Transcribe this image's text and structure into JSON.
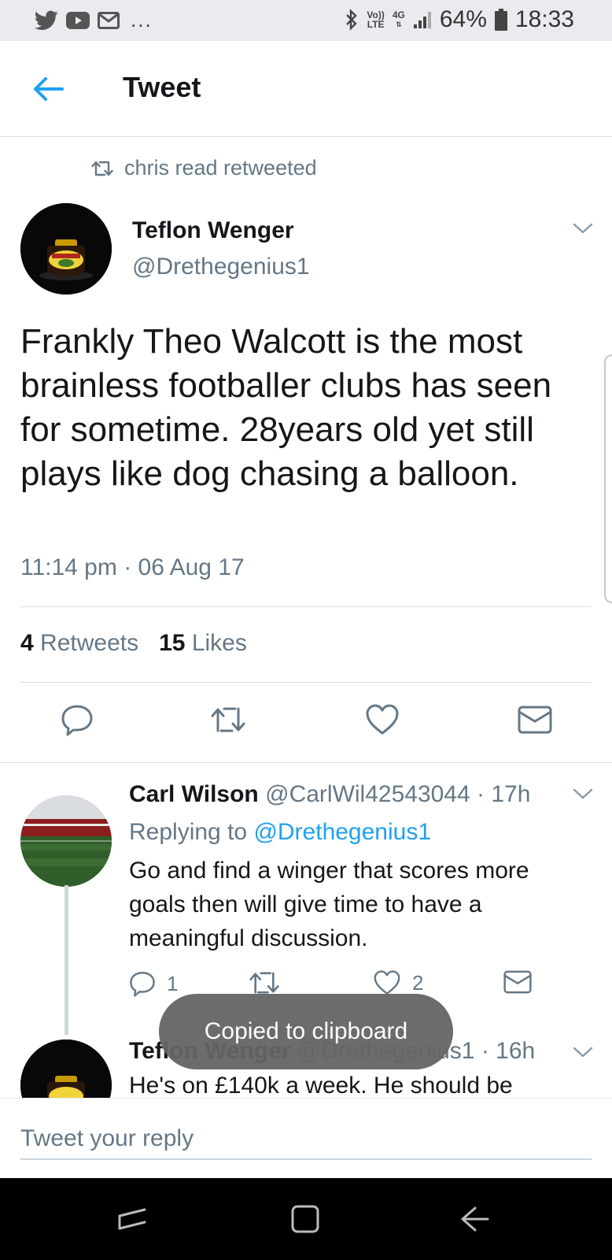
{
  "status_bar": {
    "left_icons": [
      "twitter-icon",
      "youtube-icon",
      "gmail-icon"
    ],
    "more_indicator": "...",
    "volte_top": "Vo))",
    "volte_bottom": "LTE",
    "network": "4G",
    "battery": "64%",
    "time": "18:33"
  },
  "header": {
    "title": "Tweet"
  },
  "retweet_context": {
    "text": "chris read retweeted"
  },
  "tweet": {
    "author_name": "Teflon Wenger",
    "author_handle": "@Drethegenius1",
    "text": "Frankly Theo Walcott is the most brainless footballer clubs has seen for sometime. 28years old yet still plays like dog chasing a balloon.",
    "timestamp": "11:14 pm · 06 Aug 17",
    "retweet_count": "4",
    "retweet_label": "Retweets",
    "like_count": "15",
    "like_label": "Likes"
  },
  "replies": [
    {
      "name": "Carl Wilson",
      "handle_time": "@CarlWil42543044 · 17h",
      "replying_prefix": "Replying to",
      "replying_to": "@Drethegenius1",
      "text": "Go and find a winger that scores more goals then will give time to have a meaningful discussion.",
      "reply_count": "1",
      "retweet_count": "",
      "like_count": "2"
    },
    {
      "name": "Teflon Wenger",
      "handle_time": "@Drethegenius1 · 16h",
      "text": "He's on £140k a week. He should be"
    }
  ],
  "toast": {
    "text": "Copied to clipboard"
  },
  "reply_box": {
    "placeholder": "Tweet your reply"
  },
  "colors": {
    "accent": "#1da1f2",
    "secondary_text": "#657786",
    "primary_text": "#14171a"
  }
}
